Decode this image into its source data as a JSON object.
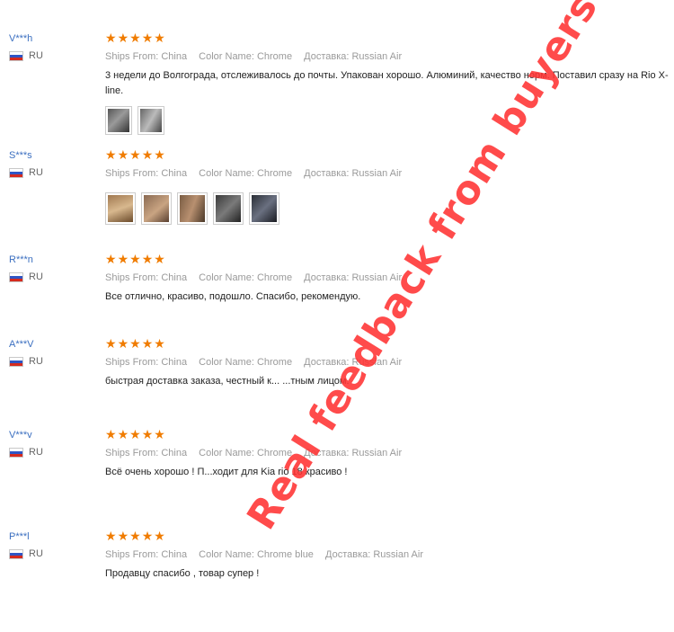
{
  "colors": {
    "star": "#f07c00",
    "username": "#3b6fc0",
    "watermark": "#ff3333"
  },
  "star_icon": "star-icon",
  "reviews": [
    {
      "user": "V***h",
      "country": "RU",
      "rating": 5,
      "ships_from": "Ships From: China",
      "color_name": "Color Name: Chrome",
      "delivery": "Доставка: Russian Air",
      "text": "3 недели до Волгограда, отслеживалось до почты. Упакован хорошо. Алюминий, качество норм. Поставил сразу на Rio X-line.",
      "photos": 2
    },
    {
      "user": "S***s",
      "country": "RU",
      "rating": 5,
      "ships_from": "Ships From: China",
      "color_name": "Color Name: Chrome",
      "delivery": "Доставка: Russian Air",
      "text": "",
      "photos": 5
    },
    {
      "user": "R***n",
      "country": "RU",
      "rating": 5,
      "ships_from": "Ships From: China",
      "color_name": "Color Name: Chrome",
      "delivery": "Доставка: Russian Air",
      "text": "Все отлично, красиво, подошло. Спасибо, рекомендую.",
      "photos": 0
    },
    {
      "user": "A***V",
      "country": "RU",
      "rating": 5,
      "ships_from": "Ships From: China",
      "color_name": "Color Name: Chrome",
      "delivery": "Доставка: Russian Air",
      "text": "быстрая доставка заказа, честный к... ...тным лицом.",
      "photos": 0
    },
    {
      "user": "V***v",
      "country": "RU",
      "rating": 5,
      "ships_from": "Ships From: China",
      "color_name": "Color Name: Chrome",
      "delivery": "Доставка: Russian Air",
      "text": "Всё очень хорошо ! П...ходит для Kia rio 18 красиво !",
      "photos": 0
    },
    {
      "user": "P***l",
      "country": "RU",
      "rating": 5,
      "ships_from": "Ships From: China",
      "color_name": "Color Name: Chrome blue",
      "delivery": "Доставка: Russian Air",
      "text": "Продавцу спасибо , товар супер !",
      "photos": 0
    }
  ],
  "watermark": "Real  feedback  from  buyers"
}
